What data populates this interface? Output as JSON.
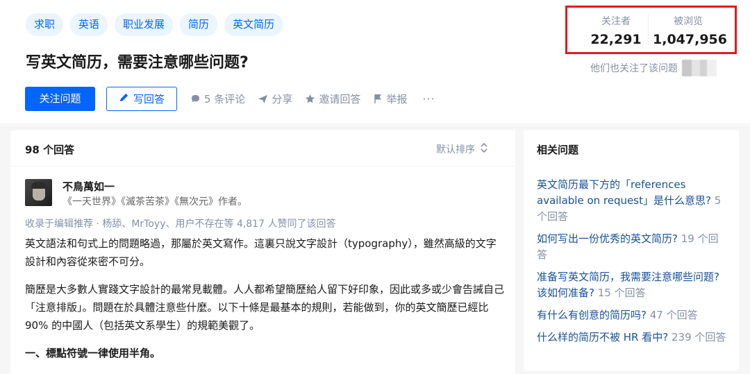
{
  "tags": [
    "求职",
    "英语",
    "职业发展",
    "简历",
    "英文简历"
  ],
  "question_title": "写英文简历，需要注意哪些问题?",
  "actions": {
    "follow": "关注问题",
    "answer": "写回答",
    "comments": "5 条评论",
    "share": "分享",
    "invite": "邀请回答",
    "report": "举报",
    "more": "···"
  },
  "stats": {
    "followers_label": "关注者",
    "followers_value": "22,291",
    "views_label": "被浏览",
    "views_value": "1,047,956",
    "highlight_color": "#e8171f"
  },
  "also_followed": "他们也关注了该问题",
  "answers": {
    "count": "98 个回答",
    "sort_label": "默认排序",
    "author_name": "不鳥萬如一",
    "author_bio": "《一天世界》《滅茶苦茶》《無次元》作者。",
    "vote_line": "收录于编辑推荐 · 杨舔、MrToyy、用户不存在等 4,817 人赞同了该回答",
    "paragraphs": [
      "英文語法和句式上的問題略過，那屬於英文寫作。這裏只說文字設計（typography），雖然高級的文字設計和內容從來密不可分。",
      "簡歷是大多數人實踐文字設計的最常見載體。人人都希望簡歷給人留下好印象，因此或多或少會告誡自己「注意排版」。問題在於具體注意些什麼。以下十條是最基本的規則，若能做到，你的英文簡歷已經比 90% 的中國人（包括英文系學生）的規範美觀了。"
    ],
    "heading1": "一、標點符號一律使用半角。"
  },
  "related": {
    "title": "相关问题",
    "items": [
      {
        "q": "英文简历最下方的「references available on request」是什么意思?",
        "count": "5 个回答"
      },
      {
        "q": "如何写出一份优秀的英文简历?",
        "count": "19 个回答"
      },
      {
        "q": "准备写英文简历，我需要注意哪些问题?该如何准备?",
        "count": "15 个回答"
      },
      {
        "q": "有什么有创意的简历吗?",
        "count": "47 个回答"
      },
      {
        "q": "什么样的简历不被 HR 看中?",
        "count": "239 个回答"
      }
    ]
  },
  "colors": {
    "accent": "#0066ff",
    "link": "#175199",
    "muted": "#8590a6",
    "tag_bg": "#ebf5ff"
  }
}
